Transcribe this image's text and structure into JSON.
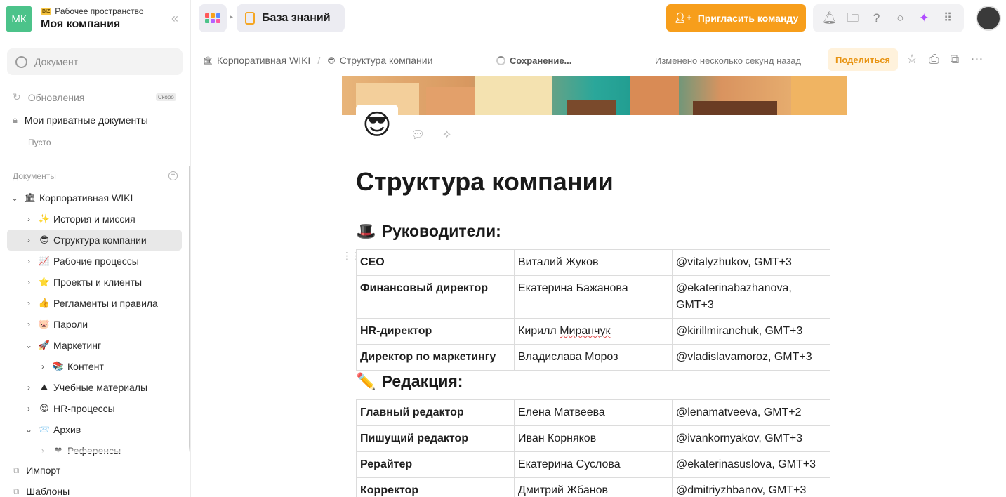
{
  "workspace": {
    "initials": "МК",
    "badge": "BIZ",
    "subtitle": "Рабочее пространство",
    "name": "Моя компания"
  },
  "sidebar": {
    "search_placeholder": "Документ",
    "updates": "Обновления",
    "updates_badge": "Скоро",
    "private_docs": "Мои приватные документы",
    "private_empty": "Пусто",
    "docs_section": "Документы",
    "tree": [
      {
        "label": "Корпоративная WIKI",
        "emoji": "🏛",
        "chevron": "⌄",
        "level": 0
      },
      {
        "label": "История и миссия",
        "emoji": "✨",
        "chevron": "›",
        "level": 1
      },
      {
        "label": "Структура компании",
        "emoji": "😎",
        "chevron": "›",
        "level": 1,
        "active": true
      },
      {
        "label": "Рабочие процессы",
        "emoji": "📈",
        "chevron": "›",
        "level": 1
      },
      {
        "label": "Проекты и клиенты",
        "emoji": "⭐",
        "chevron": "›",
        "level": 1
      },
      {
        "label": "Регламенты и правила",
        "emoji": "👍",
        "chevron": "›",
        "level": 1
      },
      {
        "label": "Пароли",
        "emoji": "🐷",
        "chevron": "›",
        "level": 1
      },
      {
        "label": "Маркетинг",
        "emoji": "🚀",
        "chevron": "⌄",
        "level": 1
      },
      {
        "label": "Контент",
        "emoji": "📚",
        "chevron": "›",
        "level": 2
      },
      {
        "label": "Учебные материалы",
        "emoji": "⛰",
        "chevron": "›",
        "level": 1
      },
      {
        "label": "HR-процессы",
        "emoji": "😌",
        "chevron": "›",
        "level": 1
      },
      {
        "label": "Архив",
        "emoji": "📨",
        "chevron": "⌄",
        "level": 1
      },
      {
        "label": "Референсы",
        "emoji": "❤",
        "chevron": "›",
        "level": 2
      }
    ],
    "import": "Импорт",
    "templates": "Шаблоны"
  },
  "topbar": {
    "kb_label": "База знаний",
    "invite_label": "Пригласить команду",
    "icons": [
      "bell-icon",
      "folder-icon",
      "help-icon",
      "search-icon",
      "sparkle-icon",
      "apps-icon"
    ]
  },
  "docbar": {
    "breadcrumb_root": "Корпоративная WIKI",
    "breadcrumb_sep": "/",
    "breadcrumb_current": "Структура компании",
    "saving": "Сохранение...",
    "changed": "Изменено несколько секунд назад",
    "share": "Поделиться"
  },
  "document": {
    "emoji": "😎",
    "title": "Структура компании",
    "section1": {
      "emoji": "🎩",
      "heading": "Руководители:"
    },
    "table1": [
      [
        "CEO",
        "Виталий Жуков",
        "@vitalyzhukov, GMT+3"
      ],
      [
        "Финансовый директор",
        "Екатерина Бажанова",
        "@ekaterinabazhanova, GMT+3"
      ],
      [
        "HR-директор",
        "Кирилл Миранчук",
        "@kirillmiranchuk, GMT+3"
      ],
      [
        "Директор по маркетингу",
        "Владислава Мороз",
        "@vladislavamoroz, GMT+3"
      ]
    ],
    "section2": {
      "emoji": "✏️",
      "heading": "Редакция:"
    },
    "table2": [
      [
        "Главный редактор",
        "Елена Матвеева",
        "@lenamatveeva, GMT+2"
      ],
      [
        "Пишущий редактор",
        "Иван Корняков",
        "@ivankornyakov, GMT+3"
      ],
      [
        "Рерайтер",
        "Екатерина Суслова",
        "@ekaterinasuslova, GMT+3"
      ],
      [
        "Корректор",
        "Дмитрий Жбанов",
        "@dmitriyzhbanov, GMT+3"
      ]
    ]
  },
  "colors": {
    "accent": "#f79e1b",
    "workspace_avatar": "#4cc38a"
  }
}
